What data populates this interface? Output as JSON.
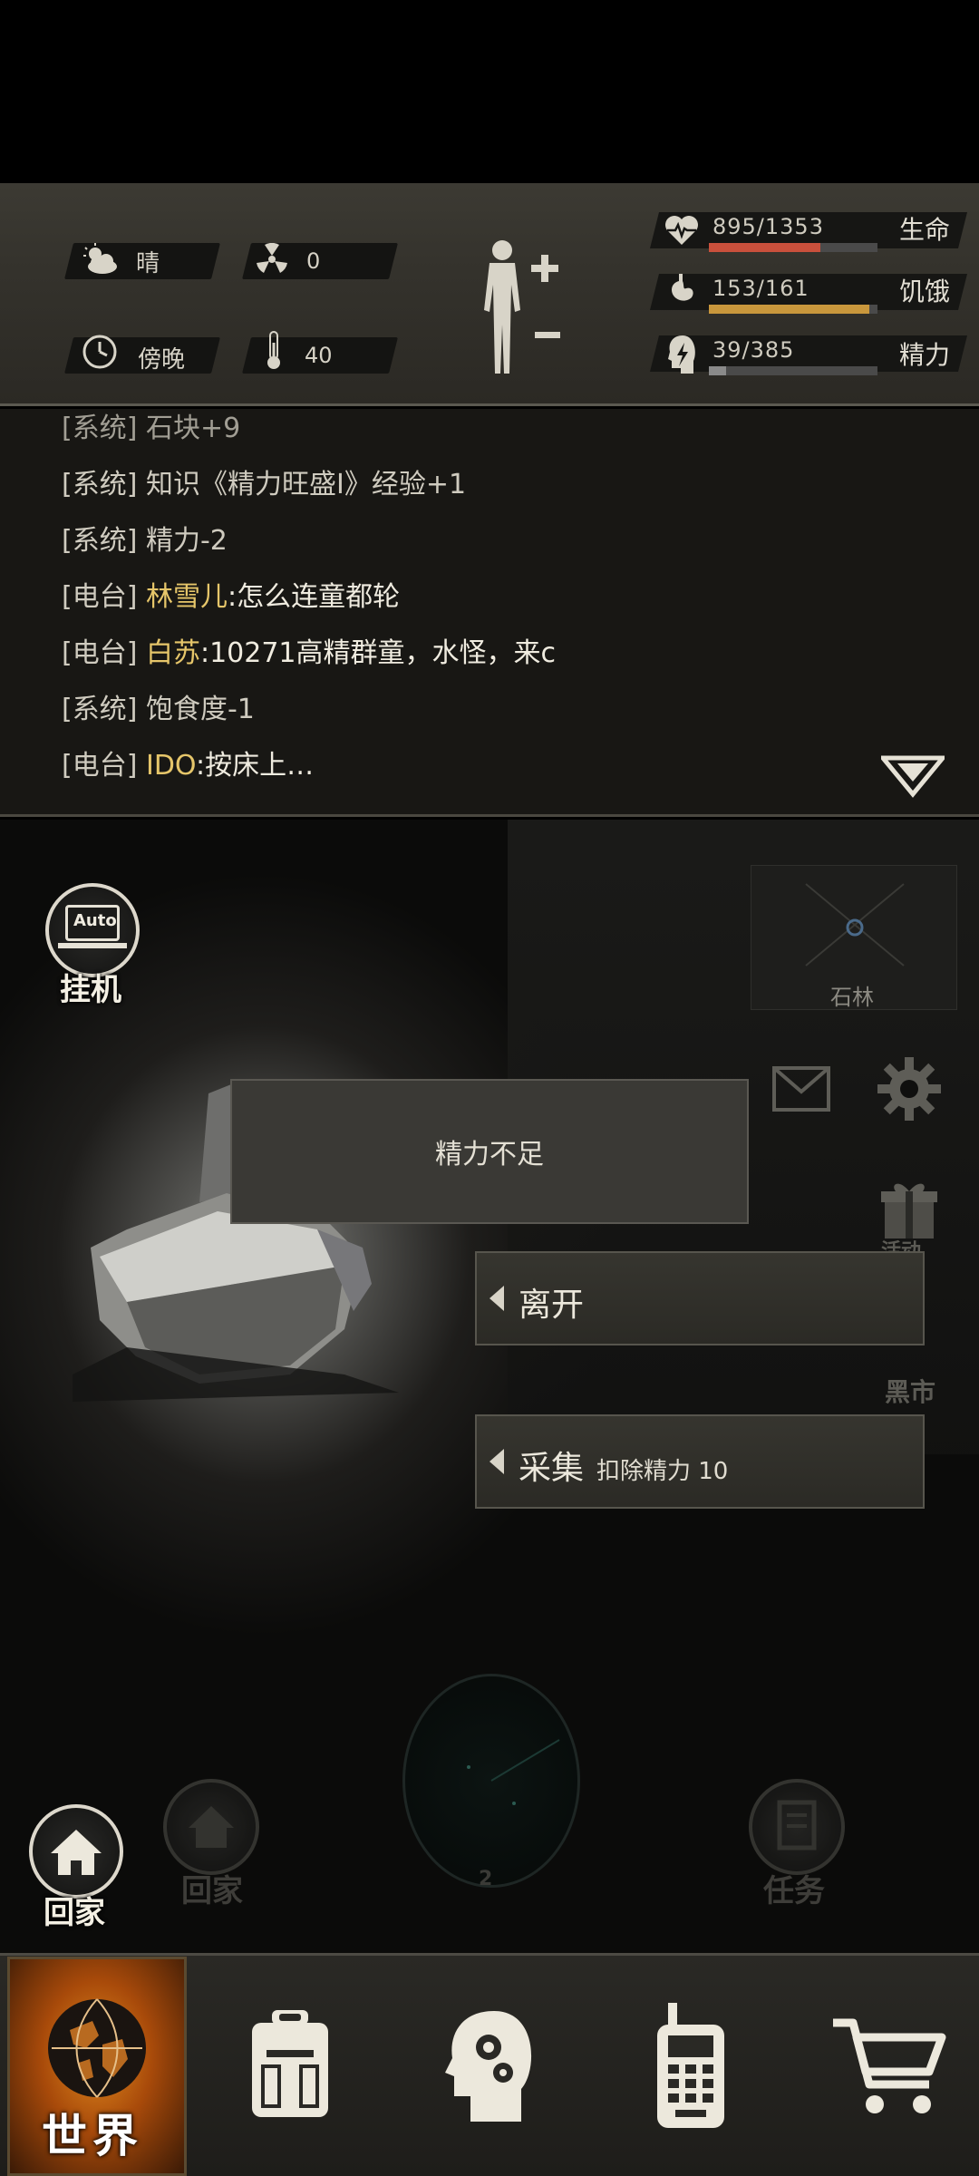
{
  "status": {
    "weather": {
      "icon": "cloud-sun-icon",
      "value": "晴"
    },
    "radiation": {
      "icon": "radiation-icon",
      "value": "0"
    },
    "time_of_day": {
      "icon": "clock-icon",
      "value": "傍晚"
    },
    "temperature": {
      "icon": "thermometer-icon",
      "value": "40"
    },
    "vitals": [
      {
        "key": "health",
        "icon": "heart-pulse-icon",
        "value": "895/1353",
        "label": "生命",
        "fraction": 0.66,
        "color": "#c9503c"
      },
      {
        "key": "hunger",
        "icon": "stomach-icon",
        "value": "153/161",
        "label": "饥饿",
        "fraction": 0.95,
        "color": "#c9973c"
      },
      {
        "key": "energy",
        "icon": "head-lightning-icon",
        "value": "39/385",
        "label": "精力",
        "fraction": 0.1,
        "color": "#8a8a8a"
      }
    ]
  },
  "chat": {
    "lines": [
      {
        "tag": "[系统]",
        "name": "",
        "text": "石块+9"
      },
      {
        "tag": "[系统]",
        "name": "",
        "text": "知识《精力旺盛Ⅰ》经验+1"
      },
      {
        "tag": "[系统]",
        "name": "",
        "text": "精力-2"
      },
      {
        "tag": "[电台]",
        "name": "林雪儿",
        "text": ":怎么连童都轮"
      },
      {
        "tag": "[电台]",
        "name": "白苏",
        "text": ":10271高精群童，水怪，来c"
      },
      {
        "tag": "[系统]",
        "name": "",
        "text": "饱食度-1"
      },
      {
        "tag": "[电台]",
        "name": "IDO",
        "text": ":按床上…"
      }
    ]
  },
  "scene": {
    "auto_badge": "Auto",
    "auto_label": "挂机",
    "map_label": "石林",
    "side_black_market": "黑市",
    "side_gift": "活动",
    "home_label": "回家",
    "home_label_faded": "回家",
    "task_label": "任务",
    "radar_count": "2",
    "message": "精力不足",
    "choices": [
      {
        "label": "离开",
        "note": ""
      },
      {
        "label": "采集",
        "note": "扣除精力 10"
      }
    ]
  },
  "nav": {
    "world_label": "世界",
    "items": [
      "backpack-icon",
      "brain-gears-icon",
      "walkie-talkie-icon",
      "shopping-cart-icon"
    ]
  }
}
